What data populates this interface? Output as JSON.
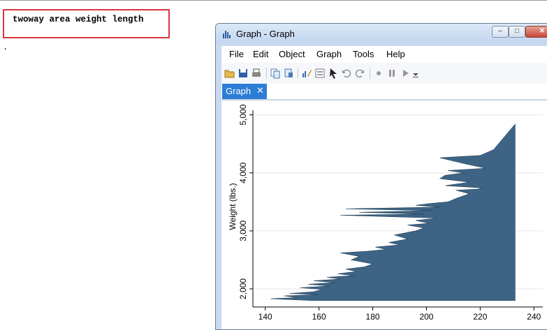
{
  "command": {
    "text": "twoway area weight length",
    "prompt_dot": "."
  },
  "window": {
    "title": "Graph - Graph",
    "controls": {
      "minimize": "–",
      "maximize": "□",
      "close": "✕"
    },
    "menu": [
      "File",
      "Edit",
      "Object",
      "Graph",
      "Tools",
      "Help"
    ],
    "toolbar_icons": [
      "open-icon",
      "save-icon",
      "print-icon",
      "copy-icon",
      "paste-icon",
      "graph-editor-icon",
      "properties-icon",
      "pointer-icon",
      "undo-icon",
      "redo-icon",
      "record-icon",
      "pause-icon",
      "play-icon",
      "more-icon"
    ],
    "tab": {
      "label": "Graph",
      "close": "✕"
    }
  },
  "chart_data": {
    "type": "area",
    "ylabel": "Weight (lbs.)",
    "xlim": [
      138,
      242
    ],
    "ylim": [
      1760,
      5080
    ],
    "xticks": [
      140,
      160,
      180,
      200,
      220,
      240
    ],
    "yticks": [
      2000,
      3000,
      4000,
      5000
    ],
    "ytick_labels": [
      "2,000",
      "3,000",
      "4,000",
      "5,000"
    ],
    "grid": true,
    "fill_color": "#3e6485",
    "baseline": 233,
    "series": [
      {
        "values": [
          [
            1800,
            157
          ],
          [
            1830,
            142
          ],
          [
            1850,
            152
          ],
          [
            1880,
            147
          ],
          [
            1900,
            160
          ],
          [
            1920,
            149
          ],
          [
            1950,
            158
          ],
          [
            1990,
            161
          ],
          [
            2020,
            153
          ],
          [
            2050,
            164
          ],
          [
            2080,
            156
          ],
          [
            2110,
            166
          ],
          [
            2140,
            158
          ],
          [
            2170,
            168
          ],
          [
            2200,
            163
          ],
          [
            2230,
            173
          ],
          [
            2260,
            167
          ],
          [
            2300,
            174
          ],
          [
            2340,
            170
          ],
          [
            2380,
            177
          ],
          [
            2430,
            180
          ],
          [
            2500,
            172
          ],
          [
            2560,
            175
          ],
          [
            2620,
            168
          ],
          [
            2650,
            178
          ],
          [
            2680,
            185
          ],
          [
            2720,
            181
          ],
          [
            2760,
            190
          ],
          [
            2800,
            186
          ],
          [
            2860,
            193
          ],
          [
            2930,
            188
          ],
          [
            3000,
            196
          ],
          [
            3050,
            199
          ],
          [
            3100,
            193
          ],
          [
            3130,
            201
          ],
          [
            3180,
            196
          ],
          [
            3220,
            204
          ],
          [
            3270,
            168
          ],
          [
            3290,
            199
          ],
          [
            3320,
            175
          ],
          [
            3350,
            202
          ],
          [
            3380,
            170
          ],
          [
            3410,
            205
          ],
          [
            3440,
            196
          ],
          [
            3470,
            201
          ],
          [
            3500,
            208
          ],
          [
            3560,
            211
          ],
          [
            3640,
            216
          ],
          [
            3700,
            211
          ],
          [
            3720,
            219
          ],
          [
            3740,
            221
          ],
          [
            3780,
            207
          ],
          [
            3820,
            213
          ],
          [
            3840,
            216
          ],
          [
            3900,
            205
          ],
          [
            3960,
            207
          ],
          [
            4000,
            214
          ],
          [
            4040,
            208
          ],
          [
            4080,
            222
          ],
          [
            4150,
            215
          ],
          [
            4260,
            205
          ],
          [
            4300,
            220
          ],
          [
            4400,
            225
          ],
          [
            4840,
            233
          ]
        ]
      }
    ]
  }
}
